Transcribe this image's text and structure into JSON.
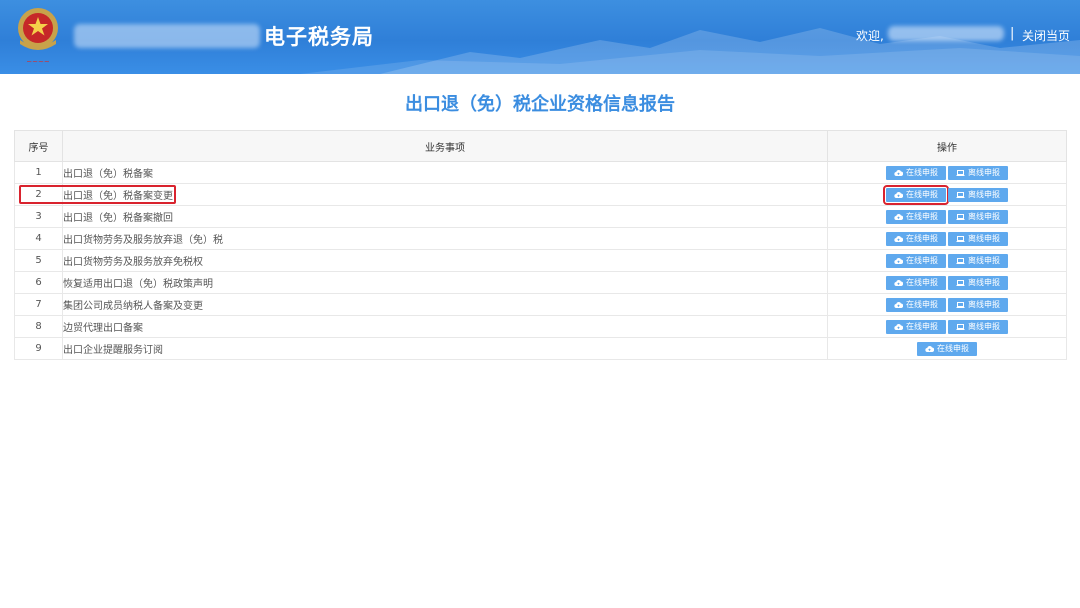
{
  "header": {
    "site_title": "电子税务局",
    "welcome": "欢迎,",
    "separator": "|",
    "close_label": "关闭当页"
  },
  "page_title": "出口退（免）税企业资格信息报告",
  "table": {
    "columns": [
      "序号",
      "业务事项",
      "操作"
    ],
    "rows": [
      {
        "num": "1",
        "item": "出口退（免）税备案",
        "online": "在线申报",
        "offline": "离线申报"
      },
      {
        "num": "2",
        "item": "出口退（免）税备案变更",
        "online": "在线申报",
        "offline": "离线申报"
      },
      {
        "num": "3",
        "item": "出口退（免）税备案撤回",
        "online": "在线申报",
        "offline": "离线申报"
      },
      {
        "num": "4",
        "item": "出口货物劳务及服务放弃退（免）税",
        "online": "在线申报",
        "offline": "离线申报"
      },
      {
        "num": "5",
        "item": "出口货物劳务及服务放弃免税权",
        "online": "在线申报",
        "offline": "离线申报"
      },
      {
        "num": "6",
        "item": "恢复适用出口退（免）税政策声明",
        "online": "在线申报",
        "offline": "离线申报"
      },
      {
        "num": "7",
        "item": "集团公司成员纳税人备案及变更",
        "online": "在线申报",
        "offline": "离线申报"
      },
      {
        "num": "8",
        "item": "边贸代理出口备案",
        "online": "在线申报",
        "offline": "离线申报"
      },
      {
        "num": "9",
        "item": "出口企业提醒服务订阅",
        "online": "在线申报",
        "offline": ""
      }
    ]
  },
  "colors": {
    "header_blue": "#2f7fd8",
    "title_blue": "#3b8de0",
    "button_blue": "#5fa9ee",
    "highlight_red": "#d9232e"
  },
  "icons": {
    "online": "cloud-upload-icon",
    "offline": "laptop-icon"
  }
}
